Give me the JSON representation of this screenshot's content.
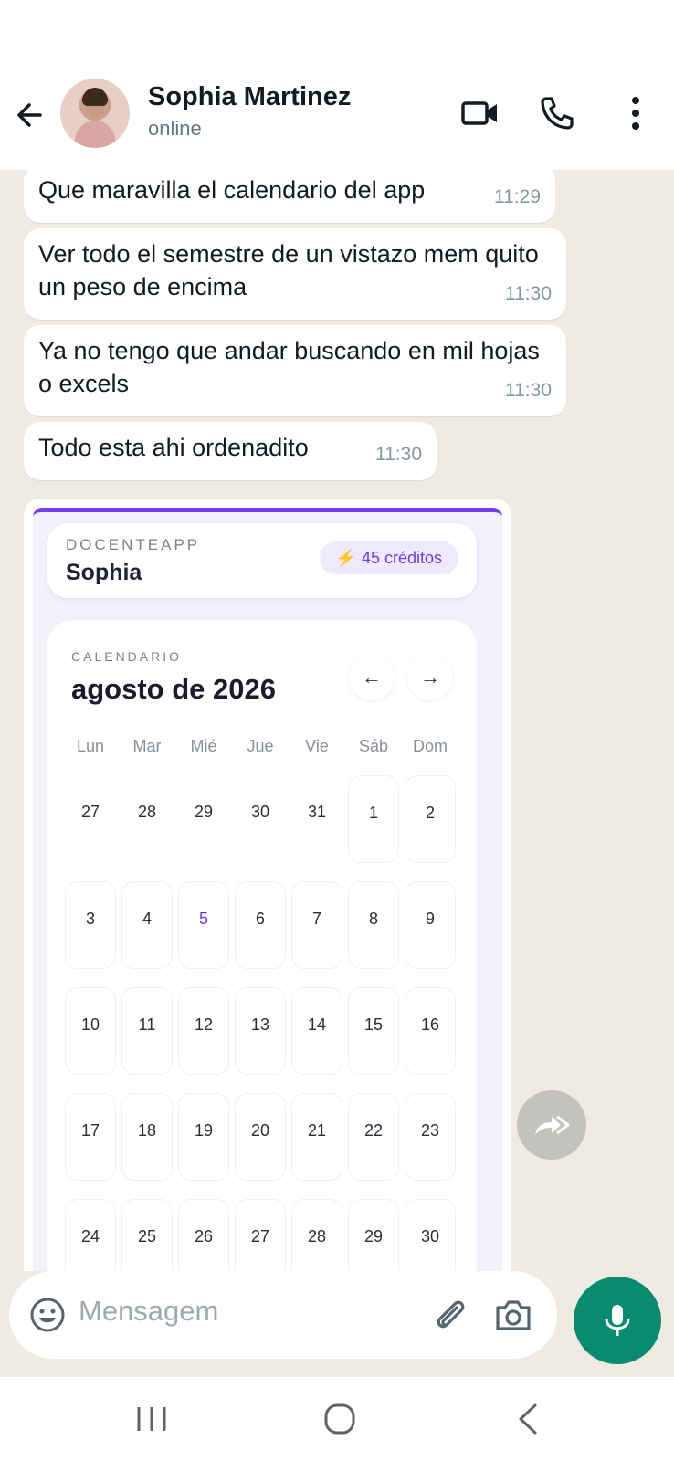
{
  "header": {
    "contact_name": "Sophia Martinez",
    "contact_status": "online"
  },
  "messages": [
    {
      "text": "Que maravilla el calendario del app",
      "time": "11:29"
    },
    {
      "text": "Ver todo el semestre de un vistazo mem quito un peso de encima",
      "time": "11:30"
    },
    {
      "text": "Ya no tengo que andar buscando en mil hojas o excels",
      "time": "11:30"
    },
    {
      "text": "Todo esta ahi ordenadito",
      "time": "11:30"
    }
  ],
  "shared_image": {
    "brand": "DOCENTEAPP",
    "user": "Sophia",
    "credits": "45 créditos",
    "calendar": {
      "label": "CALENDARIO",
      "month": "agosto de 2026",
      "prev": "←",
      "next": "→",
      "weekdays": [
        "Lun",
        "Mar",
        "Mié",
        "Jue",
        "Vie",
        "Sáb",
        "Dom"
      ],
      "weeks": [
        [
          "27",
          "28",
          "29",
          "30",
          "31",
          "1",
          "2"
        ],
        [
          "3",
          "4",
          "5",
          "6",
          "7",
          "8",
          "9"
        ],
        [
          "10",
          "11",
          "12",
          "13",
          "14",
          "15",
          "16"
        ],
        [
          "17",
          "18",
          "19",
          "20",
          "21",
          "22",
          "23"
        ],
        [
          "24",
          "25",
          "26",
          "27",
          "28",
          "29",
          "30"
        ]
      ]
    }
  },
  "composer": {
    "placeholder": "Mensagem"
  },
  "colors": {
    "accent": "#0b8a72",
    "brand_purple": "#7c3aed",
    "chat_bg": "#efeae2"
  }
}
